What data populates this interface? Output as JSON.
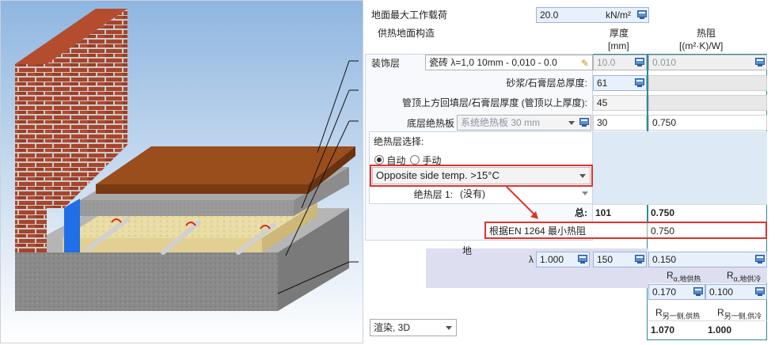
{
  "render_panel": {
    "alt": "3D floor heating construction view"
  },
  "max_load": {
    "label": "地面最大工作载荷",
    "value": "20.0",
    "unit": "kN/m²"
  },
  "construction": {
    "title": "供热地面构造",
    "col_thickness": "厚度",
    "col_thickness_unit": "[mm]",
    "col_resistance": "热阻",
    "col_resistance_unit": "[(m²·K)/W]"
  },
  "finish_layer": {
    "label": "装饰层",
    "select": "瓷砖 λ=1,0 10mm - 0,010 - 0.0",
    "thickness": "10.0",
    "resistance": "0.010"
  },
  "screed": {
    "label": "砂浆/石膏层总厚度:",
    "thickness": "61"
  },
  "above_pipe": {
    "label": "管顶上方回填层/石膏层厚度 (管顶以上厚度):",
    "thickness": "45"
  },
  "base_insulation": {
    "label": "底层绝热板",
    "select": "系统绝热板 30 mm",
    "thickness": "30",
    "resistance": "0.750"
  },
  "insulation_choice": {
    "title": "绝热层选择:",
    "radio_auto": "自动",
    "radio_manual": "手动",
    "selected": "auto",
    "opposite_select": "Opposite side temp. >15°C",
    "layer1_label": "绝热层 1:",
    "layer1_value": "(没有)"
  },
  "total": {
    "label": "总:",
    "thickness": "101",
    "resistance": "0.750"
  },
  "en1264": {
    "label": "根据EN 1264 最小热阻",
    "resistance": "0.750"
  },
  "ground": {
    "label": "地",
    "lambda_label": "λ",
    "lambda": "1.000",
    "thickness": "150",
    "resistance": "0.150",
    "r_alpha_heat_label": "R",
    "r_alpha_heat_sub": "α,地供热",
    "r_alpha_cool_label": "R",
    "r_alpha_cool_sub": "α,地供冷",
    "r_alpha_heat": "0.170",
    "r_alpha_cool": "0.100",
    "r_other_heat_label": "R",
    "r_other_heat_sub": "另一侧,供热",
    "r_other_cool_label": "R",
    "r_other_cool_sub": "另一侧,供冷",
    "r_other_heat": "1.070",
    "r_other_cool": "1.000"
  },
  "render_select": {
    "value": "渲染, 3D"
  },
  "colors": {
    "highlight_red": "#e0322b",
    "accent_teal": "#2a8c9a",
    "field_blue": "#e8f0fb"
  }
}
